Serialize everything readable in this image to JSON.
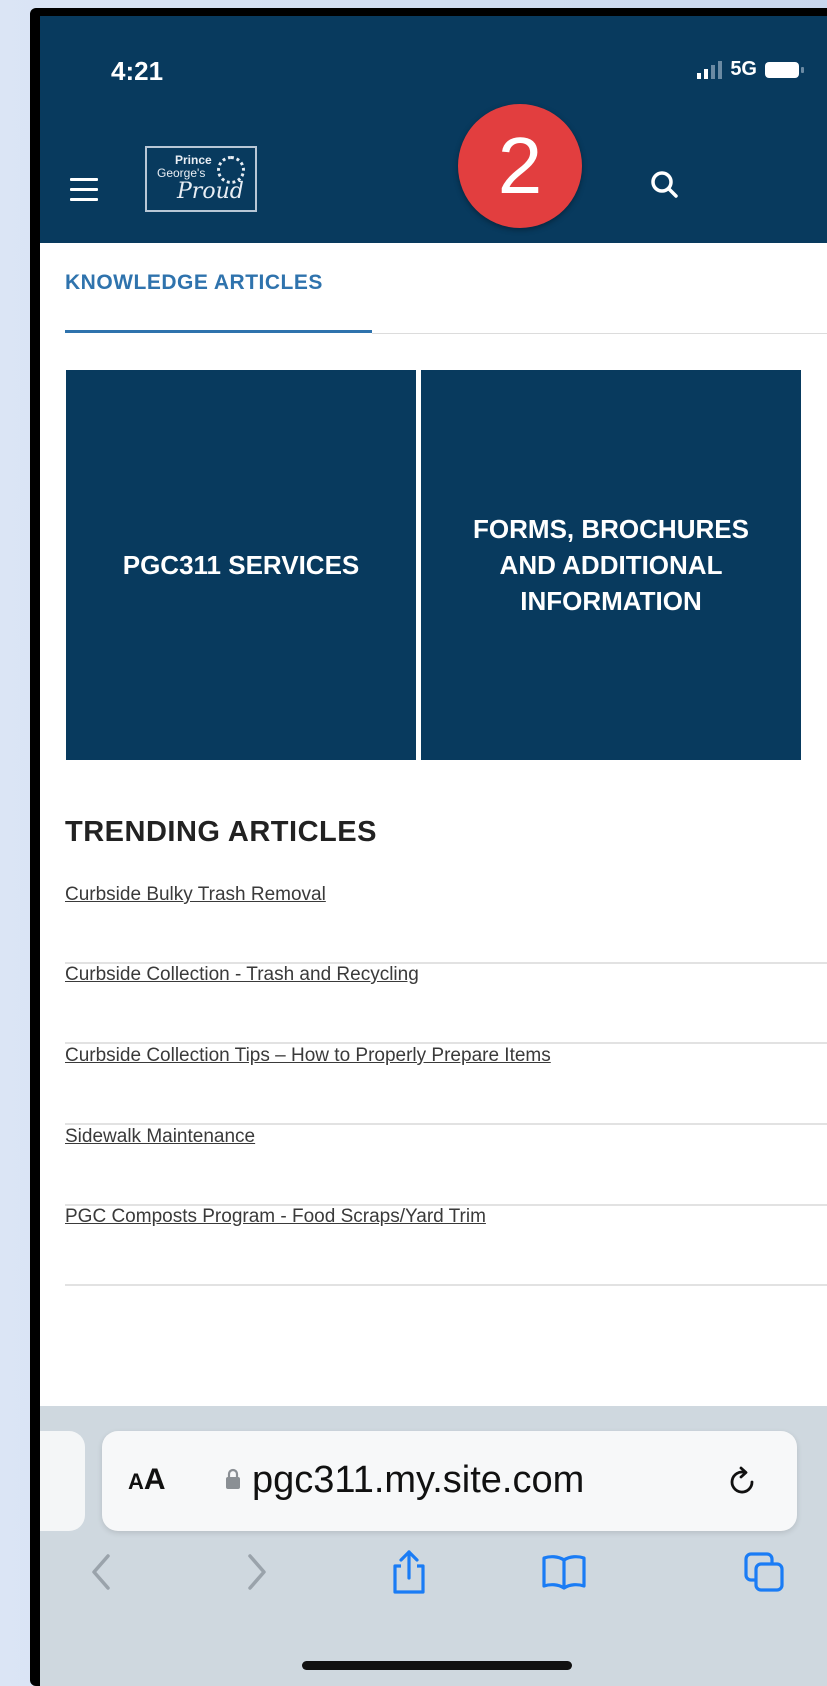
{
  "status": {
    "time": "4:21",
    "network": "5G"
  },
  "header": {
    "logo": {
      "line1": "Prince",
      "line2": "George's",
      "line3": "Proud"
    },
    "badge": "2"
  },
  "knowledge": {
    "tab_label": "KNOWLEDGE ARTICLES"
  },
  "tiles": [
    {
      "label": "PGC311 SERVICES"
    },
    {
      "label": "FORMS, BROCHURES AND ADDITIONAL INFORMATION"
    }
  ],
  "trending": {
    "heading": "TRENDING ARTICLES",
    "articles": [
      {
        "title": "Curbside Bulky Trash Removal"
      },
      {
        "title": "Curbside Collection - Trash and Recycling"
      },
      {
        "title": "Curbside Collection Tips – How to Properly Prepare Items"
      },
      {
        "title": "Sidewalk Maintenance"
      },
      {
        "title": "PGC Composts Program - Food Scraps/Yard Trim"
      }
    ]
  },
  "browser": {
    "aa_label_big": "A",
    "aa_label_small": "A",
    "url": "pgc311.my.site.com",
    "icons": [
      "back-icon",
      "forward-icon",
      "share-icon",
      "bookmarks-icon",
      "tabs-icon"
    ]
  },
  "colors": {
    "header_bg": "#083a5e",
    "accent": "#2f73ad",
    "badge": "#e23e3f"
  }
}
